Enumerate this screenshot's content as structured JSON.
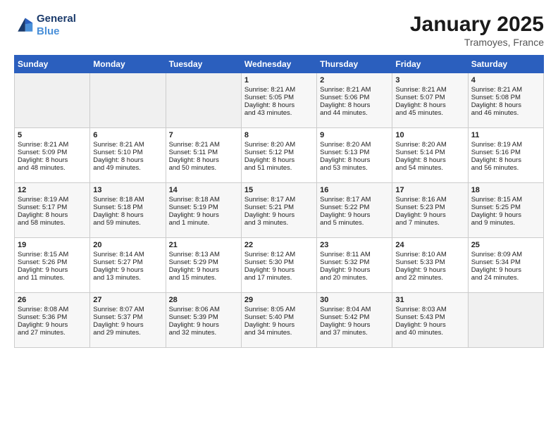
{
  "logo": {
    "line1": "General",
    "line2": "Blue"
  },
  "title": "January 2025",
  "subtitle": "Tramoyes, France",
  "days_header": [
    "Sunday",
    "Monday",
    "Tuesday",
    "Wednesday",
    "Thursday",
    "Friday",
    "Saturday"
  ],
  "weeks": [
    [
      {
        "day": "",
        "content": ""
      },
      {
        "day": "",
        "content": ""
      },
      {
        "day": "",
        "content": ""
      },
      {
        "day": "1",
        "content": "Sunrise: 8:21 AM\nSunset: 5:05 PM\nDaylight: 8 hours\nand 43 minutes."
      },
      {
        "day": "2",
        "content": "Sunrise: 8:21 AM\nSunset: 5:06 PM\nDaylight: 8 hours\nand 44 minutes."
      },
      {
        "day": "3",
        "content": "Sunrise: 8:21 AM\nSunset: 5:07 PM\nDaylight: 8 hours\nand 45 minutes."
      },
      {
        "day": "4",
        "content": "Sunrise: 8:21 AM\nSunset: 5:08 PM\nDaylight: 8 hours\nand 46 minutes."
      }
    ],
    [
      {
        "day": "5",
        "content": "Sunrise: 8:21 AM\nSunset: 5:09 PM\nDaylight: 8 hours\nand 48 minutes."
      },
      {
        "day": "6",
        "content": "Sunrise: 8:21 AM\nSunset: 5:10 PM\nDaylight: 8 hours\nand 49 minutes."
      },
      {
        "day": "7",
        "content": "Sunrise: 8:21 AM\nSunset: 5:11 PM\nDaylight: 8 hours\nand 50 minutes."
      },
      {
        "day": "8",
        "content": "Sunrise: 8:20 AM\nSunset: 5:12 PM\nDaylight: 8 hours\nand 51 minutes."
      },
      {
        "day": "9",
        "content": "Sunrise: 8:20 AM\nSunset: 5:13 PM\nDaylight: 8 hours\nand 53 minutes."
      },
      {
        "day": "10",
        "content": "Sunrise: 8:20 AM\nSunset: 5:14 PM\nDaylight: 8 hours\nand 54 minutes."
      },
      {
        "day": "11",
        "content": "Sunrise: 8:19 AM\nSunset: 5:16 PM\nDaylight: 8 hours\nand 56 minutes."
      }
    ],
    [
      {
        "day": "12",
        "content": "Sunrise: 8:19 AM\nSunset: 5:17 PM\nDaylight: 8 hours\nand 58 minutes."
      },
      {
        "day": "13",
        "content": "Sunrise: 8:18 AM\nSunset: 5:18 PM\nDaylight: 8 hours\nand 59 minutes."
      },
      {
        "day": "14",
        "content": "Sunrise: 8:18 AM\nSunset: 5:19 PM\nDaylight: 9 hours\nand 1 minute."
      },
      {
        "day": "15",
        "content": "Sunrise: 8:17 AM\nSunset: 5:21 PM\nDaylight: 9 hours\nand 3 minutes."
      },
      {
        "day": "16",
        "content": "Sunrise: 8:17 AM\nSunset: 5:22 PM\nDaylight: 9 hours\nand 5 minutes."
      },
      {
        "day": "17",
        "content": "Sunrise: 8:16 AM\nSunset: 5:23 PM\nDaylight: 9 hours\nand 7 minutes."
      },
      {
        "day": "18",
        "content": "Sunrise: 8:15 AM\nSunset: 5:25 PM\nDaylight: 9 hours\nand 9 minutes."
      }
    ],
    [
      {
        "day": "19",
        "content": "Sunrise: 8:15 AM\nSunset: 5:26 PM\nDaylight: 9 hours\nand 11 minutes."
      },
      {
        "day": "20",
        "content": "Sunrise: 8:14 AM\nSunset: 5:27 PM\nDaylight: 9 hours\nand 13 minutes."
      },
      {
        "day": "21",
        "content": "Sunrise: 8:13 AM\nSunset: 5:29 PM\nDaylight: 9 hours\nand 15 minutes."
      },
      {
        "day": "22",
        "content": "Sunrise: 8:12 AM\nSunset: 5:30 PM\nDaylight: 9 hours\nand 17 minutes."
      },
      {
        "day": "23",
        "content": "Sunrise: 8:11 AM\nSunset: 5:32 PM\nDaylight: 9 hours\nand 20 minutes."
      },
      {
        "day": "24",
        "content": "Sunrise: 8:10 AM\nSunset: 5:33 PM\nDaylight: 9 hours\nand 22 minutes."
      },
      {
        "day": "25",
        "content": "Sunrise: 8:09 AM\nSunset: 5:34 PM\nDaylight: 9 hours\nand 24 minutes."
      }
    ],
    [
      {
        "day": "26",
        "content": "Sunrise: 8:08 AM\nSunset: 5:36 PM\nDaylight: 9 hours\nand 27 minutes."
      },
      {
        "day": "27",
        "content": "Sunrise: 8:07 AM\nSunset: 5:37 PM\nDaylight: 9 hours\nand 29 minutes."
      },
      {
        "day": "28",
        "content": "Sunrise: 8:06 AM\nSunset: 5:39 PM\nDaylight: 9 hours\nand 32 minutes."
      },
      {
        "day": "29",
        "content": "Sunrise: 8:05 AM\nSunset: 5:40 PM\nDaylight: 9 hours\nand 34 minutes."
      },
      {
        "day": "30",
        "content": "Sunrise: 8:04 AM\nSunset: 5:42 PM\nDaylight: 9 hours\nand 37 minutes."
      },
      {
        "day": "31",
        "content": "Sunrise: 8:03 AM\nSunset: 5:43 PM\nDaylight: 9 hours\nand 40 minutes."
      },
      {
        "day": "",
        "content": ""
      }
    ]
  ]
}
